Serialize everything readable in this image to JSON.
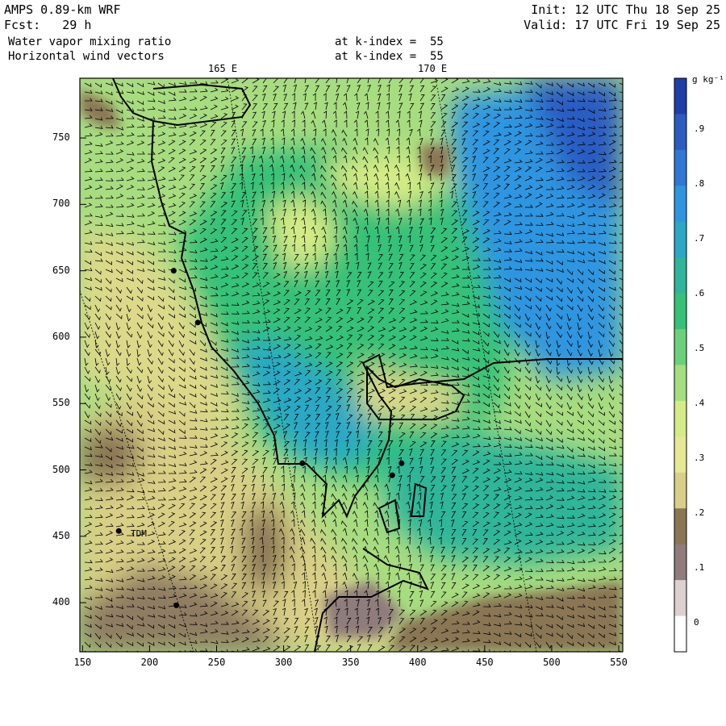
{
  "header": {
    "model": "AMPS 0.89-km WRF",
    "forecast": "Fcst:   29 h",
    "init": "Init: 12 UTC Thu 18 Sep 25",
    "valid": "Valid: 17 UTC Fri 19 Sep 25",
    "field1": "Water vapor mixing ratio",
    "field2": "Horizontal wind vectors",
    "level1": "at k-index =  55",
    "level2": "at k-index =  55"
  },
  "map": {
    "lon_labels": [
      "165 E",
      "170 E"
    ],
    "x_ticks": [
      150,
      200,
      250,
      300,
      350,
      400,
      450,
      500,
      550
    ],
    "y_ticks": [
      400,
      450,
      500,
      550,
      600,
      650,
      700,
      750
    ],
    "xlim": [
      148,
      553
    ],
    "ylim": [
      363,
      795
    ],
    "station_label": "TDM",
    "stations": [
      [
        218,
        650
      ],
      [
        236,
        611
      ],
      [
        177,
        454
      ],
      [
        220,
        398
      ],
      [
        314,
        505
      ],
      [
        381,
        496
      ],
      [
        388,
        505
      ]
    ]
  },
  "colorbar": {
    "unit": "g kg⁻¹",
    "labels": [
      ".9",
      ".8",
      ".7",
      ".6",
      ".5",
      ".4",
      ".3",
      ".2",
      ".1",
      "0"
    ],
    "colors": [
      "#1f3fa8",
      "#2a5cc2",
      "#2f78d6",
      "#2f95e0",
      "#2aa8c4",
      "#2fb59a",
      "#35c178",
      "#6ad17a",
      "#a4de7f",
      "#d5ec86",
      "#e7e894",
      "#d9cf86",
      "#8a7654",
      "#8f7c7c",
      "#dcd0d0",
      "#ffffff"
    ]
  }
}
